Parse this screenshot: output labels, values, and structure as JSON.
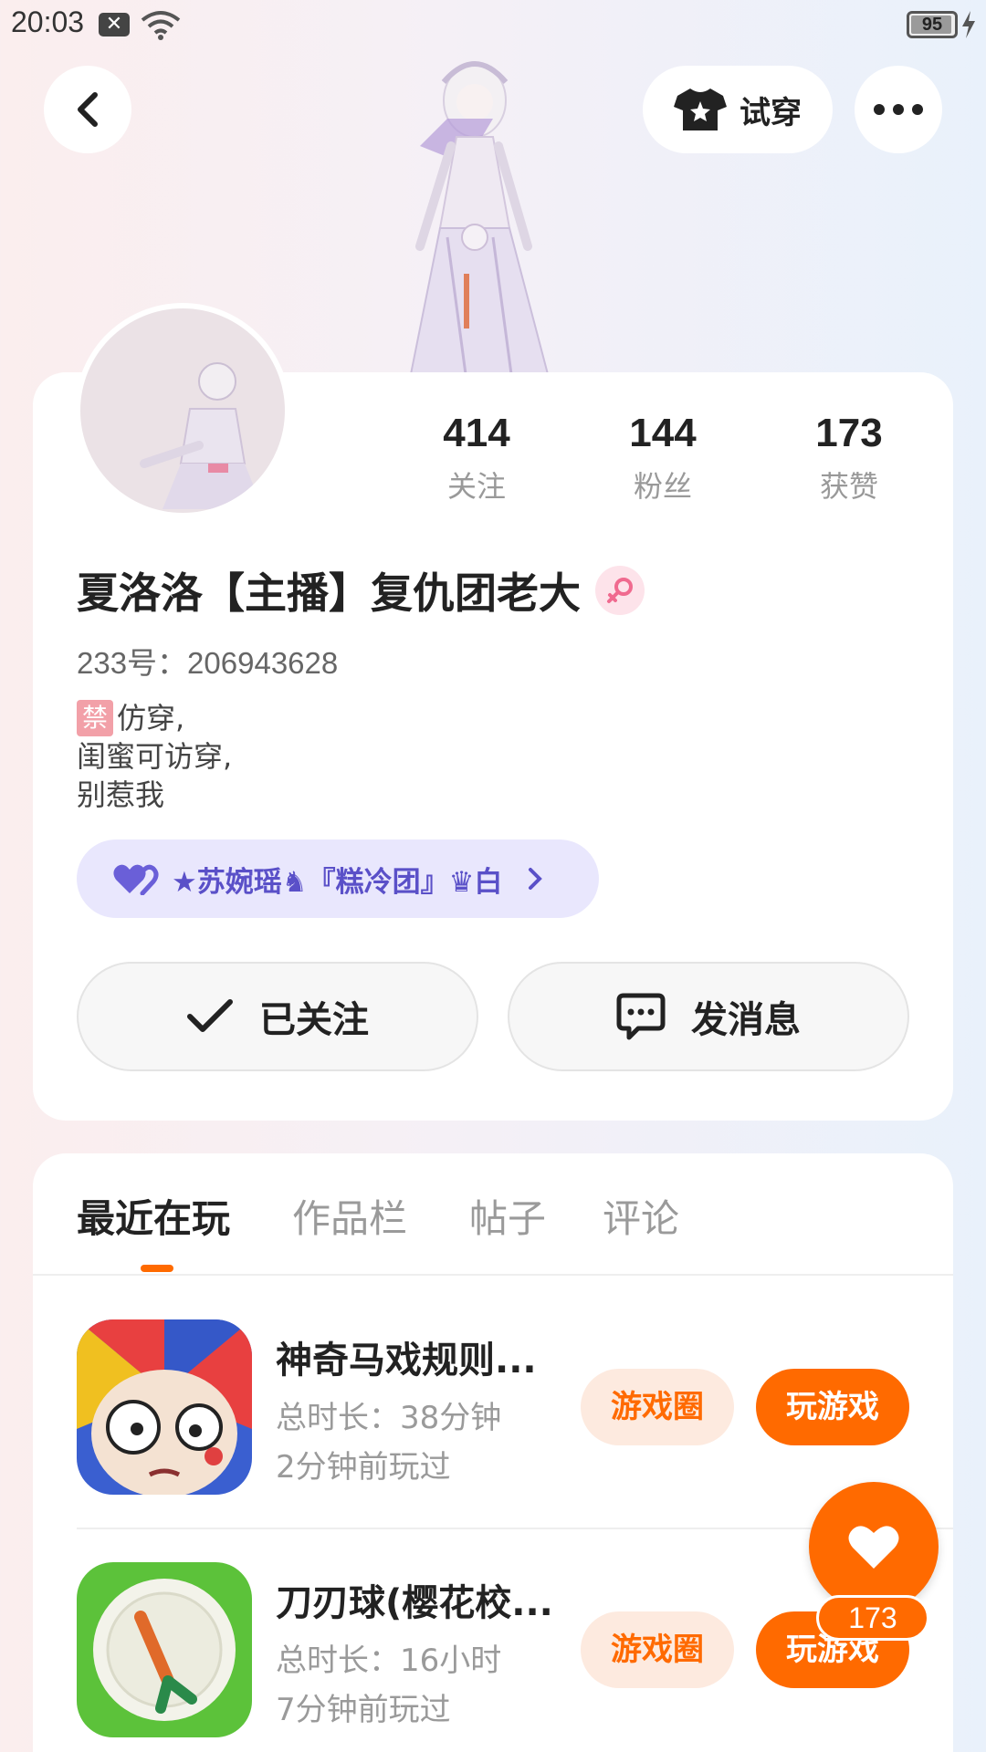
{
  "status_bar": {
    "time": "20:03",
    "notification_icon": "x-box-icon",
    "wifi_icon": "wifi-icon",
    "battery_level": "95",
    "battery_percent": 95
  },
  "top_bar": {
    "back_icon": "chevron-left-icon",
    "tryon_label": "试穿",
    "tryon_icon": "tshirt-star-icon",
    "more_icon": "more-dots-icon"
  },
  "profile": {
    "stats": [
      {
        "value": "414",
        "label": "关注"
      },
      {
        "value": "144",
        "label": "粉丝"
      },
      {
        "value": "173",
        "label": "获赞"
      }
    ],
    "nickname": "夏洛洛【主播】复仇团老大",
    "gender_icon": "female-icon",
    "user_id": "233号：206943628",
    "bio": {
      "forbid_badge": "禁",
      "line1": "仿穿,",
      "line2": "闺蜜可访穿,",
      "line3": "别惹我"
    },
    "guild": {
      "icon": "double-heart-icon",
      "text": "★苏婉瑶♞『糕冷团』♛白"
    },
    "follow_button": "已关注",
    "message_button": "发消息"
  },
  "tabs": [
    {
      "label": "最近在玩",
      "active": true
    },
    {
      "label": "作品栏",
      "active": false
    },
    {
      "label": "帖子",
      "active": false
    },
    {
      "label": "评论",
      "active": false
    }
  ],
  "games": [
    {
      "name": "神奇马戏规则...",
      "duration": "总时长：38分钟",
      "last_played": "2分钟前玩过",
      "circle_label": "游戏圈",
      "play_label": "玩游戏"
    },
    {
      "name": "刀刃球(樱花校...",
      "duration": "总时长：16小时",
      "last_played": "7分钟前玩过",
      "circle_label": "游戏圈",
      "play_label": "玩游戏"
    }
  ],
  "like_fab": {
    "icon": "heart-icon",
    "count": "173"
  },
  "colors": {
    "accent": "#ff6a00",
    "guild_bg": "#e9e7fd",
    "guild_text": "#5a50c8"
  }
}
